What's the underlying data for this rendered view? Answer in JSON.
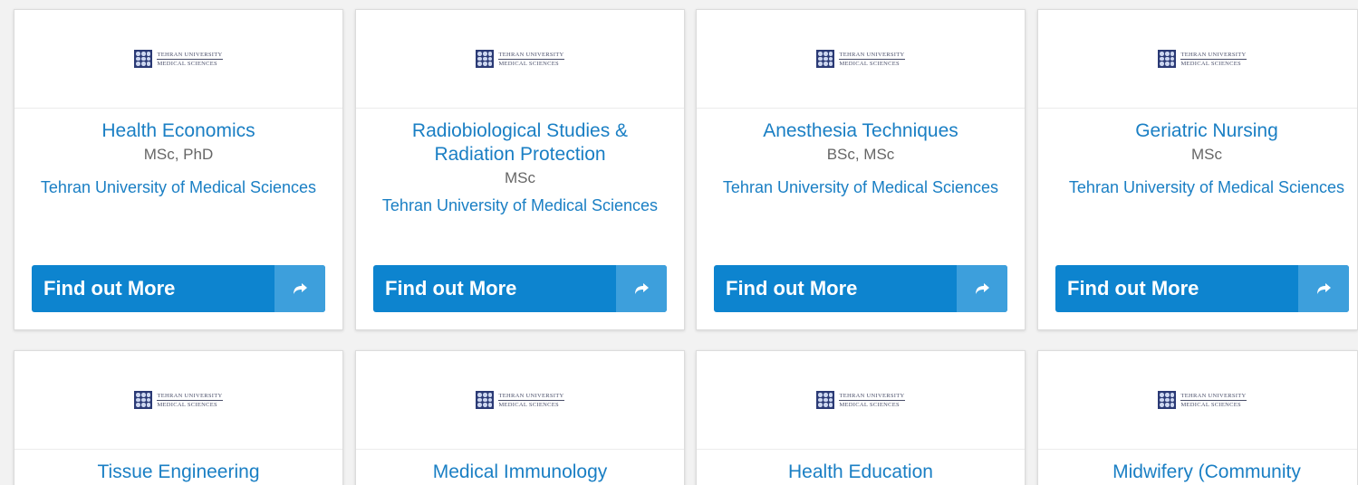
{
  "logo": {
    "line1": "Tehran University",
    "line2": "of",
    "line3": "Medical Sciences"
  },
  "cards": [
    {
      "title": "Health Economics",
      "degree": "MSc, PhD",
      "university": "Tehran University of Medical Sciences",
      "button_label": "Find out More",
      "button_icon": "share-arrow-icon"
    },
    {
      "title": "Radiobiological Studies & Radiation Protection",
      "degree": "MSc",
      "university": "Tehran University of Medical Sciences",
      "button_label": "Find out More",
      "button_icon": "share-arrow-icon"
    },
    {
      "title": "Anesthesia Techniques",
      "degree": "BSc, MSc",
      "university": "Tehran University of Medical Sciences",
      "button_label": "Find out More",
      "button_icon": "share-arrow-icon"
    },
    {
      "title": "Geriatric Nursing",
      "degree": "MSc",
      "university": "Tehran University of Medical Sciences",
      "button_label": "Find out More",
      "button_icon": "share-arrow-icon"
    },
    {
      "title": "Tissue Engineering"
    },
    {
      "title": "Medical Immunology"
    },
    {
      "title": "Health Education"
    },
    {
      "title": "Midwifery (Community"
    }
  ],
  "colors": {
    "accent": "#1a7fc4",
    "button": "#0d84cf",
    "button_icon_bg": "#3d9fdc",
    "muted_text": "#666666"
  }
}
